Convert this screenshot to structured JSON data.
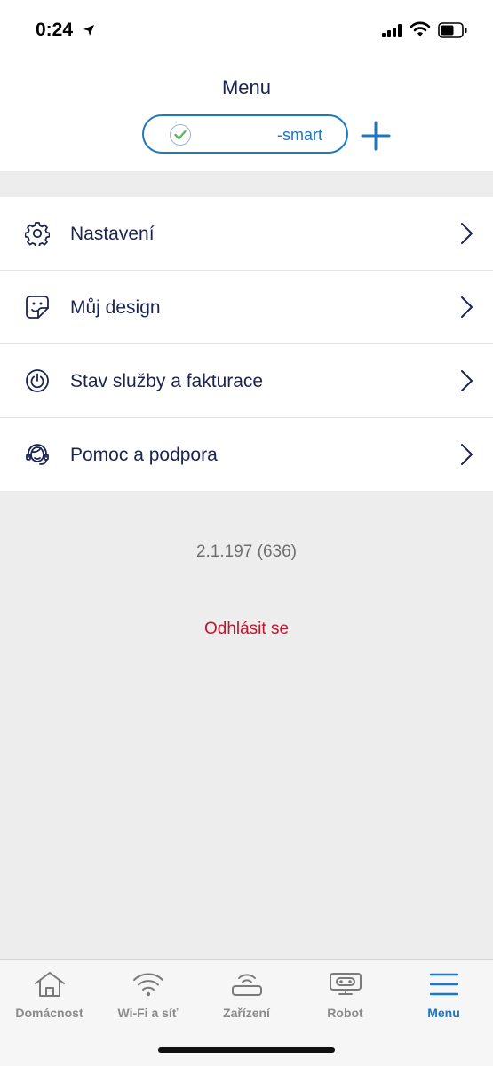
{
  "status_bar": {
    "time": "0:24",
    "icons": [
      "location-arrow-icon",
      "cellular-signal-icon",
      "wifi-icon",
      "battery-icon"
    ]
  },
  "header": {
    "title": "Menu",
    "network_name": "-smart",
    "network_status_icon": "check-circle-icon",
    "add_icon": "plus-icon"
  },
  "menu": {
    "items": [
      {
        "label": "Nastavení",
        "icon": "gear-icon"
      },
      {
        "label": "Můj design",
        "icon": "sticker-face-icon"
      },
      {
        "label": "Stav služby a fakturace",
        "icon": "power-icon"
      },
      {
        "label": "Pomoc a podpora",
        "icon": "support-agent-icon"
      }
    ]
  },
  "version": "2.1.197 (636)",
  "logout_label": "Odhlásit se",
  "tab_bar": {
    "tabs": [
      {
        "label": "Domácnost",
        "icon": "home-icon",
        "active": false
      },
      {
        "label": "Wi-Fi a síť",
        "icon": "wifi-icon",
        "active": false
      },
      {
        "label": "Zařízení",
        "icon": "router-icon",
        "active": false
      },
      {
        "label": "Robot",
        "icon": "robot-icon",
        "active": false
      },
      {
        "label": "Menu",
        "icon": "hamburger-menu-icon",
        "active": true
      }
    ]
  },
  "colors": {
    "accent": "#1b78c2",
    "text_primary": "#1c2452",
    "logout": "#c0152f",
    "background": "#ededed",
    "check_green": "#5cb85c"
  }
}
